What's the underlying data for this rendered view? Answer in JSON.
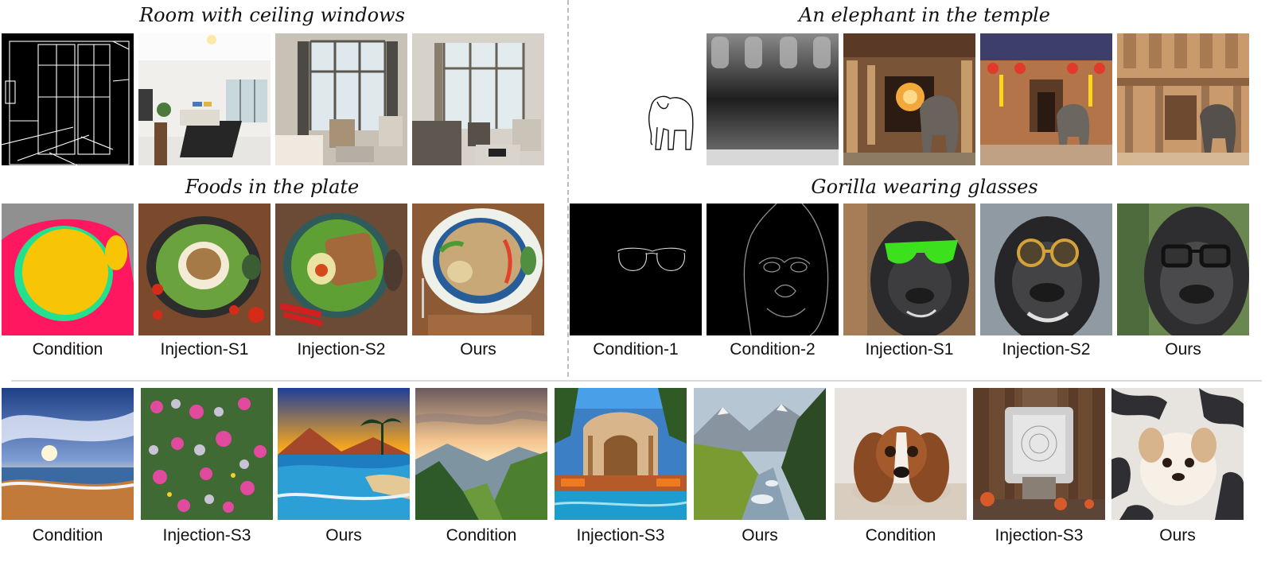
{
  "sections": {
    "room": {
      "title": "Room with ceiling windows"
    },
    "elephant": {
      "title": "An elephant in the temple"
    },
    "foods": {
      "title": "Foods in the plate"
    },
    "gorilla": {
      "title": "Gorilla wearing glasses"
    }
  },
  "labels": {
    "left_top": [
      "Condition",
      "Injection-S1",
      "Injection-S2",
      "Ours"
    ],
    "right_top": [
      "Condition-1",
      "Condition-2",
      "Injection-S1",
      "Injection-S2",
      "Ours"
    ],
    "bottom": [
      "Condition",
      "Injection-S3",
      "Ours",
      "Condition",
      "Injection-S3",
      "Ours",
      "Condition",
      "Injection-S3",
      "Ours"
    ]
  },
  "panels": {
    "row1": [
      "room-canny-edge-map",
      "room-injection-s1",
      "room-injection-s2",
      "room-ours",
      "elephant-sketch",
      "elephant-depth-map",
      "elephant-injection-s1",
      "elephant-injection-s2",
      "elephant-ours"
    ],
    "row2": [
      "food-segmentation-map",
      "food-injection-s1",
      "food-injection-s2",
      "food-ours",
      "glasses-sketch",
      "gorilla-edge-map",
      "gorilla-injection-s1",
      "gorilla-injection-s2",
      "gorilla-ours"
    ],
    "row3": [
      "beach-sunset-condition",
      "flowers-injection-s3",
      "tropical-beach-ours",
      "mountain-valley-condition",
      "resort-pool-injection-s3",
      "mountain-river-ours",
      "puppy-condition",
      "watch-injection-s3",
      "fluffy-puppy-ours"
    ]
  }
}
